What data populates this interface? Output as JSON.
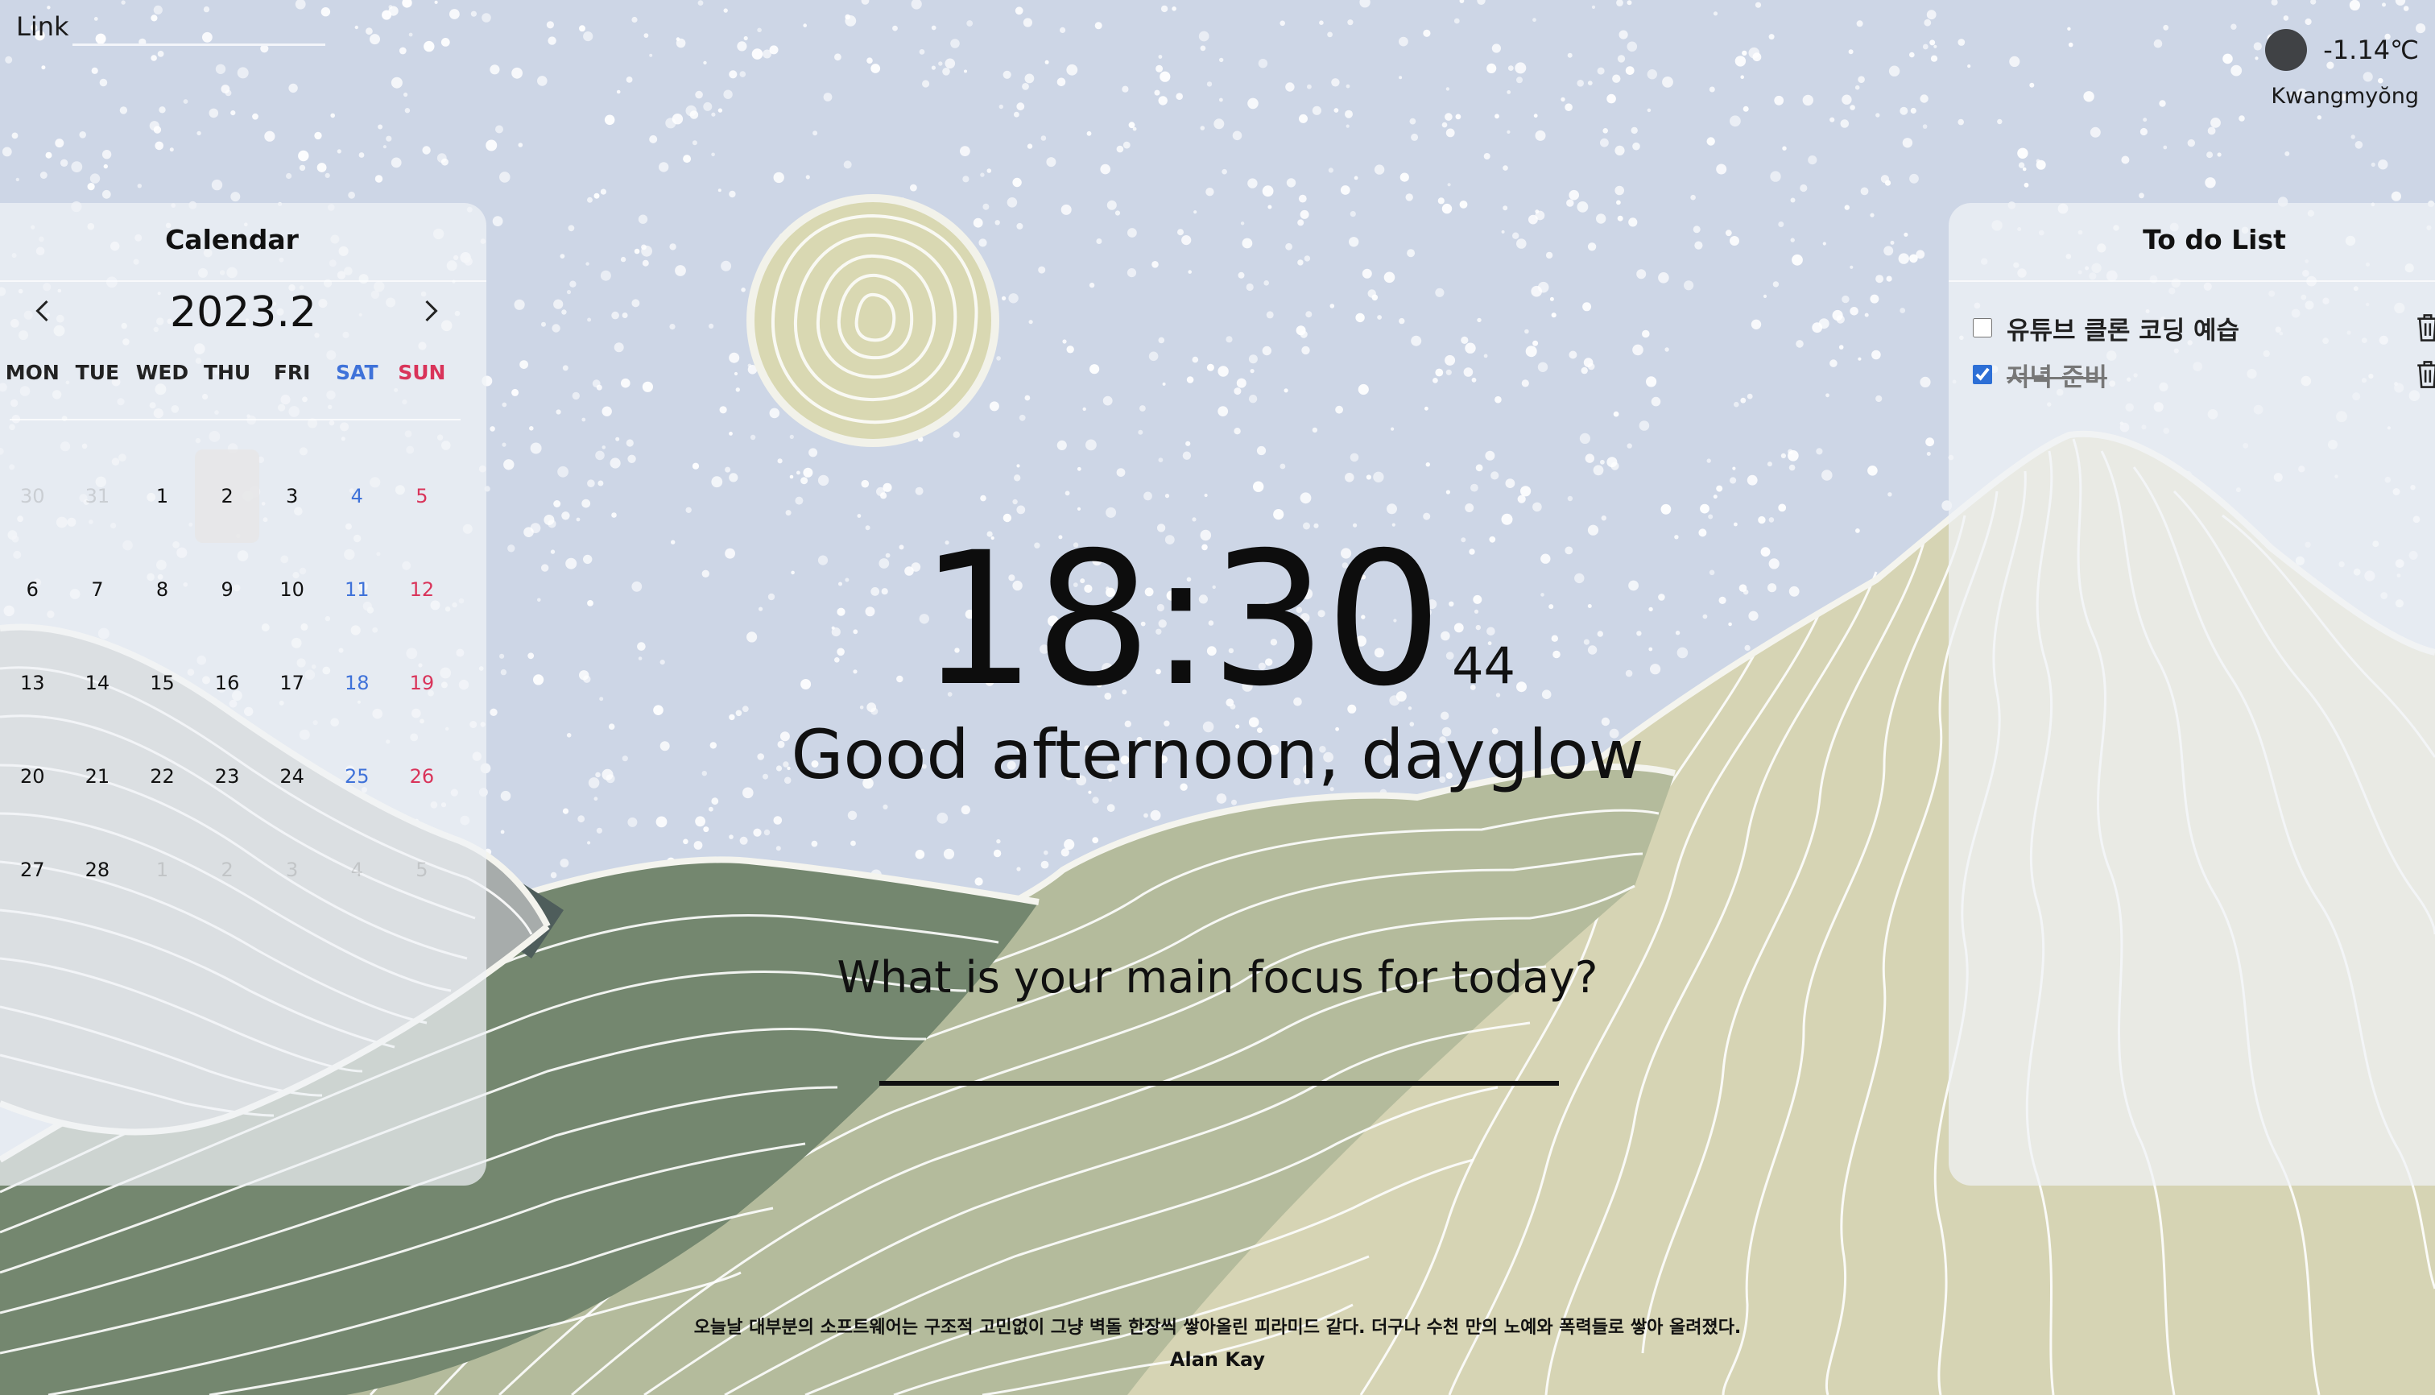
{
  "link": {
    "label": "Link",
    "value": ""
  },
  "weather": {
    "temperature": "-1.14℃",
    "city": "Kwangmyŏng",
    "icon": "weather-icon"
  },
  "calendar": {
    "title": "Calendar",
    "month_label": "2023.2",
    "days_of_week": [
      "MON",
      "TUE",
      "WED",
      "THU",
      "FRI",
      "SAT",
      "SUN"
    ],
    "weeks": [
      [
        "30",
        "31",
        "1",
        "2",
        "3",
        "4",
        "5"
      ],
      [
        "6",
        "7",
        "8",
        "9",
        "10",
        "11",
        "12"
      ],
      [
        "13",
        "14",
        "15",
        "16",
        "17",
        "18",
        "19"
      ],
      [
        "20",
        "21",
        "22",
        "23",
        "24",
        "25",
        "26"
      ],
      [
        "27",
        "28",
        "1",
        "2",
        "3",
        "4",
        "5"
      ]
    ],
    "today": "2"
  },
  "todo": {
    "title": "To do List",
    "items": [
      {
        "text": "유튜브 클론 코딩 예습",
        "done": false
      },
      {
        "text": "저녁 준비",
        "done": true
      }
    ]
  },
  "clock": {
    "time": "18:30",
    "seconds": "44"
  },
  "greeting": "Good afternoon, dayglow",
  "focus": {
    "question": "What is your main focus for today?",
    "value": ""
  },
  "quote": {
    "text": "오늘날 대부분의 소프트웨어는 구조적 고민없이 그냥 벽돌 한장씩 쌓아올린 피라미드 같다. 더구나 수천 만의 노예와 폭력들로 쌓아 올려졌다.",
    "author": "Alan Kay"
  },
  "colors": {
    "sky": "#cdd6e6",
    "sun": "#d9d8b2",
    "hill_dark": "#4e5d5b",
    "hill_green": "#74876f",
    "hill_sage": "#b3bb9b",
    "hill_light": "#d6d4b4",
    "hill_grey": "#a9aeaa",
    "saturday": "#3f72d9",
    "sunday": "#d9345a"
  }
}
